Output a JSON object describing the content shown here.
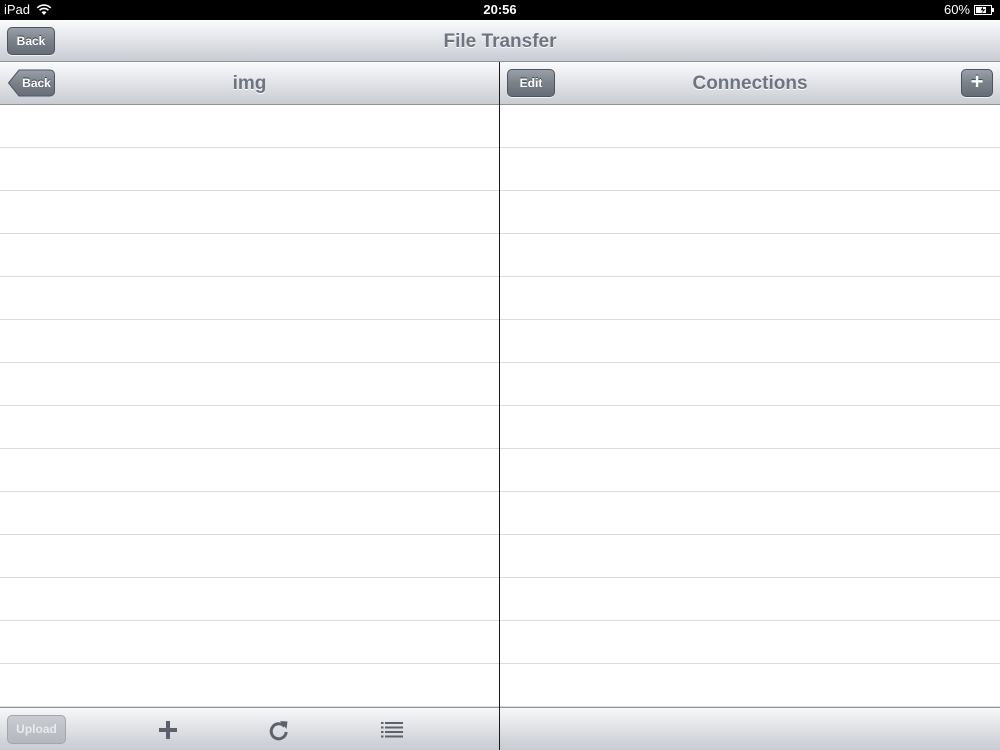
{
  "status_bar": {
    "device": "iPad",
    "time": "20:56",
    "battery": "60%",
    "icons": [
      "wifi-icon",
      "battery-icon"
    ]
  },
  "main_nav": {
    "back_label": "Back",
    "title": "File Transfer"
  },
  "left_pane": {
    "back_label": "Back",
    "title": "img",
    "row_count": 14,
    "toolbar": {
      "upload_label": "Upload",
      "icons": [
        "plus-icon",
        "refresh-icon",
        "list-icon"
      ]
    }
  },
  "right_pane": {
    "edit_label": "Edit",
    "title": "Connections",
    "add_label": "+",
    "row_count": 14
  },
  "colors": {
    "title_text": "#6e7480",
    "button_fill": "#7b818b",
    "divider": "#1a1a1a",
    "row_separator": "#dcdcdc"
  }
}
